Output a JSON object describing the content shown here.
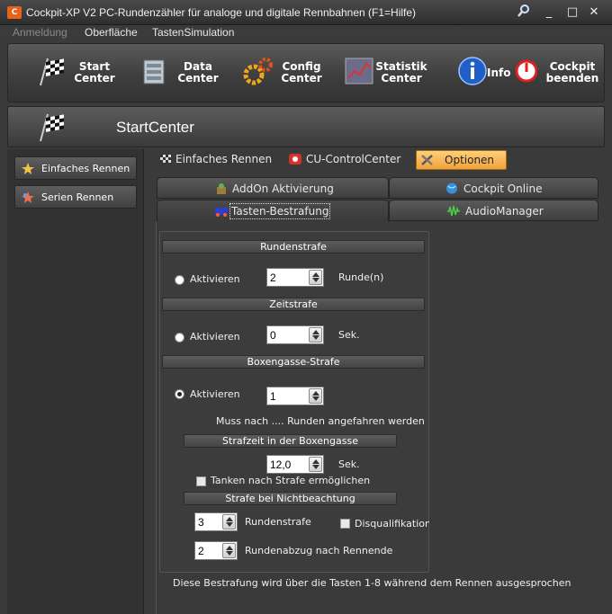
{
  "window": {
    "icon_text": "C",
    "title": "Cockpit-XP V2 PC-Rundenzähler für analoge und digitale Rennbahnen (F1=Hilfe)",
    "buttons": [
      "magnifier-icon",
      "minimize",
      "maximize",
      "close"
    ]
  },
  "menu": {
    "anmeldung": "Anmeldung",
    "oberflaeche": "Oberfläche",
    "tastensimulation": "TastenSimulation"
  },
  "toolbar": {
    "start": "Start\nCenter",
    "data": "Data\nCenter",
    "config": "Config\nCenter",
    "statistik": "Statistik\nCenter",
    "info": "Info",
    "cockpit": "Cockpit\nbeenden"
  },
  "section": {
    "title": "StartCenter"
  },
  "sidebar": {
    "items": [
      {
        "label": "Einfaches Rennen"
      },
      {
        "label": "Serien Rennen"
      }
    ]
  },
  "tabs": {
    "top": [
      {
        "label": "Einfaches Rennen"
      },
      {
        "label": "CU-ControlCenter"
      },
      {
        "label": "Optionen"
      }
    ],
    "sub": [
      {
        "label": "AddOn Aktivierung"
      },
      {
        "label": "Cockpit Online"
      },
      {
        "label": "Tasten-Bestrafung"
      },
      {
        "label": "AudioManager"
      }
    ]
  },
  "panel": {
    "rundenstrafe": {
      "header": "Rundenstrafe",
      "radio_label": "Aktivieren",
      "value": "2",
      "unit": "Runde(n)"
    },
    "zeitstrafe": {
      "header": "Zeitstrafe",
      "radio_label": "Aktivieren",
      "value": "0",
      "unit": "Sek."
    },
    "boxengasse": {
      "header": "Boxengasse-Strafe",
      "radio_label": "Aktivieren",
      "value": "1",
      "note": "Muss nach .... Runden angefahren werden",
      "strafzeit_header": "Strafzeit in der Boxengasse",
      "strafzeit_value": "12,0",
      "strafzeit_unit": "Sek.",
      "tanken_label": "Tanken nach Strafe ermöglichen",
      "nichtbeachtung_header": "Strafe bei Nichtbeachtung",
      "rundenstrafe_value": "3",
      "rundenstrafe_label": "Rundenstrafe",
      "disqualifikation_label": "Disqualifikation",
      "rundenabzug_value": "2",
      "rundenabzug_label": "Rundenabzug nach Rennende"
    }
  },
  "footer": {
    "text": "Diese Bestrafung wird über die Tasten 1-8 während dem Rennen ausgesprochen"
  },
  "colors": {
    "accent_tab": "#f0a23a",
    "background": "#3a3a3a"
  }
}
